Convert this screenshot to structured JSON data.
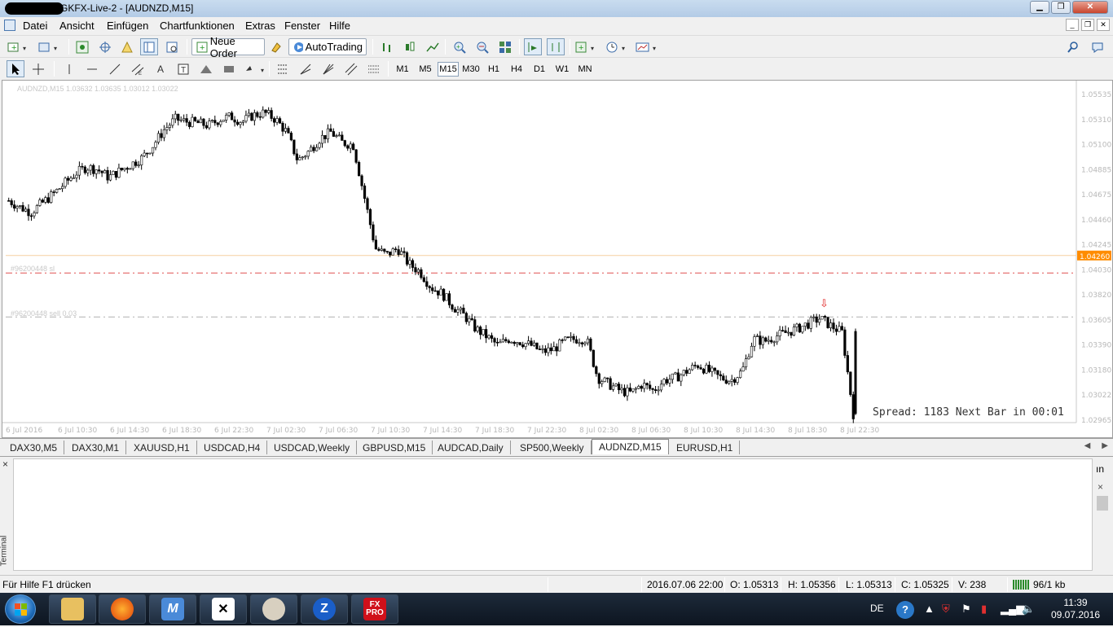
{
  "window": {
    "title": "GKFX-Live-2 - [AUDNZD,M15]"
  },
  "menu": {
    "items": [
      "Datei",
      "Ansicht",
      "Einfügen",
      "Chartfunktionen",
      "Extras",
      "Fenster",
      "Hilfe"
    ]
  },
  "toolbar1": {
    "new_order_label": "Neue Order",
    "autotrading_label": "AutoTrading"
  },
  "toolbar2": {
    "timeframes": [
      "M1",
      "M5",
      "M15",
      "M30",
      "H1",
      "H4",
      "D1",
      "W1",
      "MN"
    ],
    "active_timeframe": "M15"
  },
  "chart": {
    "info_text": "AUDNZD,M15  1.03632 1.03635 1.03012 1.03022",
    "spread_text": "Spread: 1183 Next Bar in 00:01",
    "trade_sl_label": "#96200448 sl",
    "trade_sell_label": "#96200448 sell 0.03",
    "sell_arrow_icon": "down-arrow-icon",
    "bid_color": "#ff8c00",
    "line_color_sl": "#e05050",
    "line_color_entry": "#b0b0b0"
  },
  "chart_data": {
    "type": "candlestick",
    "title": "AUDNZD,M15",
    "price_axis_ticks": [
      "1.05535",
      "1.05310",
      "1.05100",
      "1.04885",
      "1.04675",
      "1.04460",
      "1.04245",
      "1.04030",
      "1.03820",
      "1.03605",
      "1.03390",
      "1.03180",
      "1.03022",
      "1.02965"
    ],
    "current_price_label": "1.04260",
    "time_axis_ticks": [
      "6 Jul 2016",
      "6 Jul 10:30",
      "6 Jul 14:30",
      "6 Jul 18:30",
      "6 Jul 22:30",
      "7 Jul 02:30",
      "7 Jul 06:30",
      "7 Jul 10:30",
      "7 Jul 14:30",
      "7 Jul 18:30",
      "7 Jul 22:30",
      "8 Jul 02:30",
      "8 Jul 06:30",
      "8 Jul 10:30",
      "8 Jul 14:30",
      "8 Jul 18:30",
      "8 Jul 22:30"
    ],
    "ylim": [
      1.02965,
      1.05535
    ],
    "sl_level": 1.0411,
    "entry_level": 1.0377,
    "ohlc_close_path": [
      1.0467,
      1.0462,
      1.0458,
      1.0465,
      1.0472,
      1.048,
      1.0488,
      1.0493,
      1.0491,
      1.0485,
      1.049,
      1.0495,
      1.05,
      1.051,
      1.0522,
      1.053,
      1.0528,
      1.0527,
      1.0525,
      1.053,
      1.0532,
      1.0528,
      1.0533,
      1.0535,
      1.053,
      1.052,
      1.0498,
      1.0505,
      1.0515,
      1.052,
      1.0512,
      1.051,
      1.047,
      1.043,
      1.0425,
      1.043,
      1.0418,
      1.0412,
      1.04,
      1.0395,
      1.0385,
      1.0378,
      1.0368,
      1.0362,
      1.0355,
      1.036,
      1.0358,
      1.0355,
      1.035,
      1.0352,
      1.0358,
      1.036,
      1.036,
      1.033,
      1.0325,
      1.032,
      1.0318,
      1.0325,
      1.032,
      1.0328,
      1.033,
      1.0335,
      1.034,
      1.0335,
      1.033,
      1.0328,
      1.0335,
      1.036,
      1.0358,
      1.0362,
      1.0365,
      1.0368,
      1.0372,
      1.0376,
      1.037,
      1.0365,
      1.0302
    ]
  },
  "tabs": {
    "items": [
      "DAX30,M5",
      "DAX30,M1",
      "XAUUSD,H1",
      "USDCAD,H4",
      "USDCAD,Weekly",
      "GBPUSD,M15",
      "AUDCAD,Daily",
      "SP500,Weekly",
      "AUDNZD,M15",
      "EURUSD,H1"
    ],
    "active": "AUDNZD,M15"
  },
  "terminal": {
    "label": "Terminal",
    "close": "×",
    "right_text": "ın",
    "right_close": "×"
  },
  "statusbar": {
    "help": "Für Hilfe F1 drücken",
    "date": "2016.07.06 22:00",
    "open": "O: 1.05313",
    "high": "H: 1.05356",
    "low": "L: 1.05313",
    "close": "C: 1.05325",
    "volume": "V: 238",
    "traffic": "96/1 kb"
  },
  "taskbar": {
    "apps": [
      "explorer",
      "firefox",
      "metatrader",
      "xtrade",
      "paint",
      "zorro",
      "fxpro"
    ],
    "fxpro_label": "FX PRO",
    "lang": "DE",
    "time": "11:39",
    "date": "09.07.2016"
  }
}
